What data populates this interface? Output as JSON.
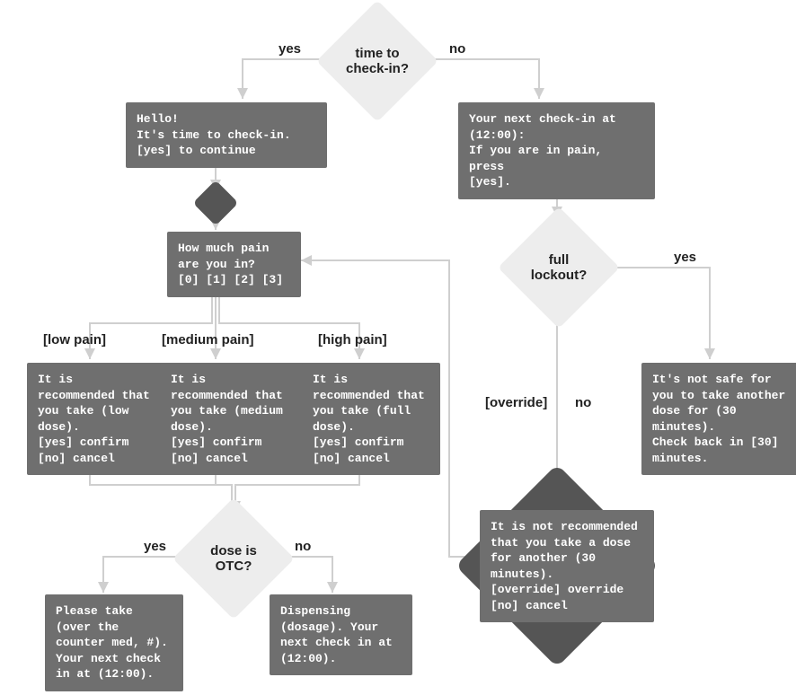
{
  "decisions": {
    "checkin": "time to\ncheck-in?",
    "lockout": "full\nlockout?",
    "otc": "dose is\nOTC?"
  },
  "edges": {
    "yes": "yes",
    "no": "no",
    "low": "[low pain]",
    "med": "[medium pain]",
    "high": "[high pain]",
    "override": "[override]"
  },
  "boxes": {
    "greet": "Hello!\nIt's time to check-in.\n[yes] to continue",
    "next_checkin": "Your next check-in at\n(12:00):\nIf you are in pain, press\n[yes].",
    "pain_scale": "How much pain\nare you in?\n[0] [1] [2] [3]",
    "low_dose": "It is\nrecommended that\nyou take (low\ndose).\n[yes] confirm\n[no] cancel",
    "med_dose": "It is\nrecommended that\nyou take (medium\ndose).\n[yes] confirm\n[no] cancel",
    "high_dose": "It is\nrecommended that\nyou take (full\ndose).\n[yes] confirm\n[no] cancel",
    "otc_yes": "Please take\n(over the\ncounter med, #).\nYour next check\nin at (12:00).",
    "otc_no": "Dispensing\n(dosage). Your\nnext check in at\n(12:00).",
    "lockout_yes": "It's not safe for\nyou to take another\ndose for (30\nminutes).\nCheck back in [30]\nminutes.",
    "lockout_no": "It is not recommended\nthat you take a dose\nfor another (30\nminutes).\n[override] override\n[no] cancel"
  }
}
